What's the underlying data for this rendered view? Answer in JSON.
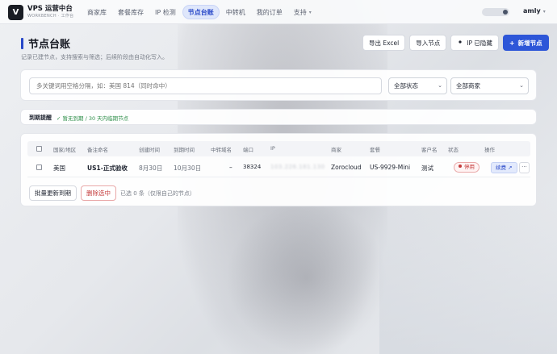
{
  "app": {
    "logo_letter": "V",
    "title": "VPS 运营中台",
    "subtitle": "WORKBENCH · 工作台"
  },
  "nav": {
    "items": [
      {
        "label": "商家库",
        "active": false
      },
      {
        "label": "套餐库存",
        "active": false
      },
      {
        "label": "IP 检测",
        "active": false
      },
      {
        "label": "节点台账",
        "active": true
      },
      {
        "label": "中转机",
        "active": false
      },
      {
        "label": "我的订单",
        "active": false
      },
      {
        "label": "支持",
        "active": false
      }
    ],
    "support_caret": "▾"
  },
  "user": {
    "name": "amly",
    "caret": "▾"
  },
  "header": {
    "title": "节点台账",
    "subtitle": "记录已建节点，支持搜索与筛选；后续阶段由自动化写入。"
  },
  "actions": {
    "export_label": "导出 Excel",
    "import_label": "导入节点",
    "ip_hidden_label": "IP 已隐藏",
    "ip_hidden_icon": "eye-off-icon",
    "add_label": "新增节点",
    "add_icon": "plus-icon"
  },
  "search": {
    "placeholder": "多关键词用空格分隔，如：美国 814（同时命中）",
    "value": "",
    "status_select": "全部状态",
    "vendor_select": "全部商家"
  },
  "expire": {
    "title": "到期提醒",
    "message": "✓ 暂无到期 / 30 天内临期节点"
  },
  "table": {
    "headers": [
      "国家/地区",
      "备注命名",
      "创建时间",
      "到期时间",
      "中转域名",
      "端口",
      "IP",
      "商家",
      "套餐",
      "客户名",
      "状态",
      "操作"
    ],
    "rows": [
      {
        "country": "美国",
        "name": "US1-正式验收",
        "created": "8月30日",
        "expires": "10月30日",
        "relay_domain": "–",
        "port": "38324",
        "ip": "103.226.181.130",
        "vendor": "Zorocloud",
        "plan": "US-9929-Mini",
        "customer": "测试",
        "status": "停用",
        "renew_label": "续费 ↗",
        "more_label": "···"
      }
    ]
  },
  "footer": {
    "bulk_label": "批量更新到期",
    "delete_label": "删除选中",
    "selection_info": "已选 0 条（仅限自己的节点）"
  },
  "colors": {
    "accent": "#2d56d8",
    "danger": "#c43b3b",
    "success": "#2f8f4a"
  }
}
